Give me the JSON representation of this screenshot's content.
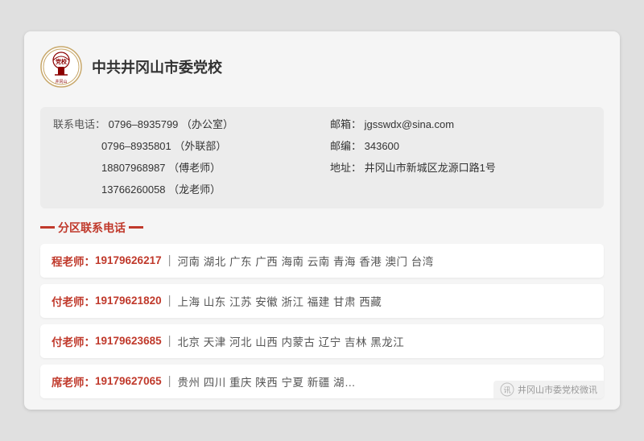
{
  "header": {
    "school_name": "中共井冈山市委党校"
  },
  "contact": {
    "phones": [
      {
        "label": "联系电话：",
        "number": "0796–8935799",
        "note": "（办公室）"
      },
      {
        "label": "",
        "number": "0796–8935801",
        "note": "（外联部）"
      },
      {
        "label": "",
        "number": "18807968987",
        "note": "（傅老师）"
      },
      {
        "label": "",
        "number": "13766260058",
        "note": "（龙老师）"
      }
    ],
    "email_label": "邮箱：",
    "email": "jgsswdx@sina.com",
    "postcode_label": "邮编：",
    "postcode": "343600",
    "address_label": "地址：",
    "address": "井冈山市新城区龙源口路1号"
  },
  "section_title": "分区联系电话",
  "districts": [
    {
      "teacher": "程老师：",
      "phone": "19179626217",
      "regions": "河南  湖北  广东  广西  海南  云南  青海  香港  澳门  台湾"
    },
    {
      "teacher": "付老师：",
      "phone": "19179621820",
      "regions": "上海  山东  江苏  安徽  浙江  福建  甘肃  西藏"
    },
    {
      "teacher": "付老师：",
      "phone": "19179623685",
      "regions": "北京  天津  河北  山西  内蒙古  辽宁  吉林  黑龙江"
    },
    {
      "teacher": "席老师：",
      "phone": "19179627065",
      "regions": "贵州  四川  重庆  陕西  宁夏  新疆  湖…"
    }
  ],
  "watermark": "井冈山市委党校微讯"
}
